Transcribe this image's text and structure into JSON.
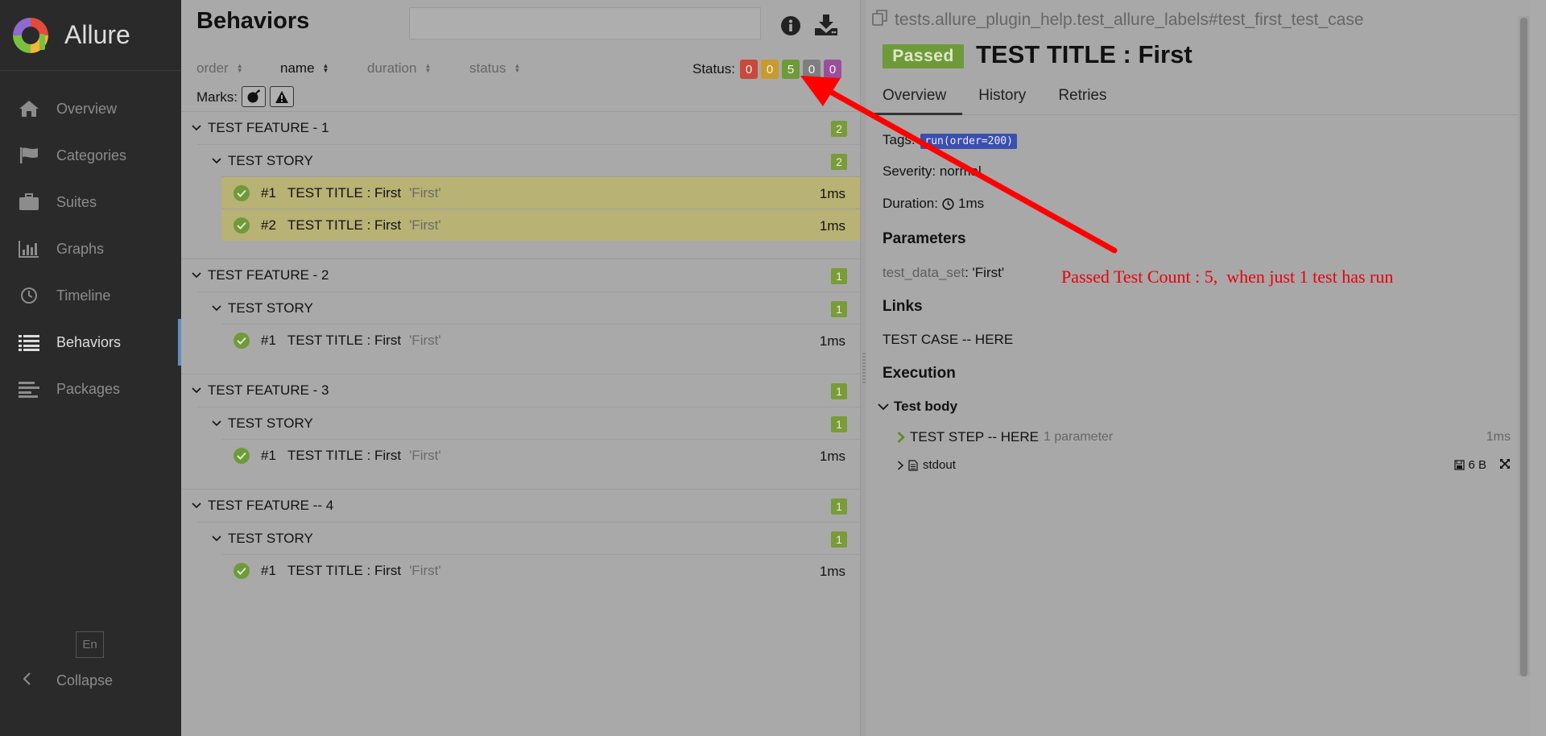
{
  "sidebar": {
    "brand": "Allure",
    "items": [
      {
        "label": "Overview",
        "icon": "home-icon"
      },
      {
        "label": "Categories",
        "icon": "flag-icon"
      },
      {
        "label": "Suites",
        "icon": "briefcase-icon"
      },
      {
        "label": "Graphs",
        "icon": "bar-chart-icon"
      },
      {
        "label": "Timeline",
        "icon": "clock-icon"
      },
      {
        "label": "Behaviors",
        "icon": "list-icon",
        "active": true
      },
      {
        "label": "Packages",
        "icon": "align-left-icon"
      }
    ],
    "language": "En",
    "collapse_label": "Collapse"
  },
  "list": {
    "title": "Behaviors",
    "search_value": "",
    "sort": {
      "order": "order",
      "name": "name",
      "duration": "duration",
      "status": "status"
    },
    "status_label": "Status:",
    "status_counts": [
      {
        "value": "0",
        "color": "#c9493a"
      },
      {
        "value": "0",
        "color": "#c99a2e"
      },
      {
        "value": "5",
        "color": "#6f9a3a"
      },
      {
        "value": "0",
        "color": "#7e7e7e"
      },
      {
        "value": "0",
        "color": "#9b4f9b"
      }
    ],
    "marks_label": "Marks:",
    "features": [
      {
        "name": "TEST FEATURE - 1",
        "count": "2",
        "story": {
          "name": "TEST STORY",
          "count": "2"
        },
        "tests": [
          {
            "num": "#1",
            "title": "TEST TITLE : First",
            "param": "'First'",
            "duration": "1ms",
            "highlight": true
          },
          {
            "num": "#2",
            "title": "TEST TITLE : First",
            "param": "'First'",
            "duration": "1ms",
            "highlight": true
          }
        ]
      },
      {
        "name": "TEST FEATURE - 2",
        "count": "1",
        "story": {
          "name": "TEST STORY",
          "count": "1"
        },
        "tests": [
          {
            "num": "#1",
            "title": "TEST TITLE : First",
            "param": "'First'",
            "duration": "1ms"
          }
        ]
      },
      {
        "name": "TEST FEATURE - 3",
        "count": "1",
        "story": {
          "name": "TEST STORY",
          "count": "1"
        },
        "tests": [
          {
            "num": "#1",
            "title": "TEST TITLE : First",
            "param": "'First'",
            "duration": "1ms"
          }
        ]
      },
      {
        "name": "TEST FEATURE -- 4",
        "count": "1",
        "story": {
          "name": "TEST STORY",
          "count": "1"
        },
        "tests": [
          {
            "num": "#1",
            "title": "TEST TITLE : First",
            "param": "'First'",
            "duration": "1ms"
          }
        ]
      }
    ]
  },
  "detail": {
    "breadcrumb": "tests.allure_plugin_help.test_allure_labels#test_first_test_case",
    "status": "Passed",
    "title": "TEST TITLE : First",
    "tabs": [
      "Overview",
      "History",
      "Retries"
    ],
    "tags_label": "Tags:",
    "tag": "run(order=200)",
    "severity_label": "Severity:",
    "severity": "normal",
    "duration_label": "Duration:",
    "duration": "1ms",
    "parameters_head": "Parameters",
    "param_key": "test_data_set",
    "param_value": "'First'",
    "links_head": "Links",
    "link": "TEST CASE -- HERE",
    "execution_head": "Execution",
    "body_label": "Test body",
    "step": {
      "name": "TEST STEP -- HERE",
      "meta": "1 parameter",
      "duration": "1ms"
    },
    "attachment": {
      "name": "stdout",
      "size": "6 B"
    }
  },
  "annotation": {
    "text": "Passed Test Count : 5,  when just 1 test has run",
    "color": "#e8000c"
  }
}
